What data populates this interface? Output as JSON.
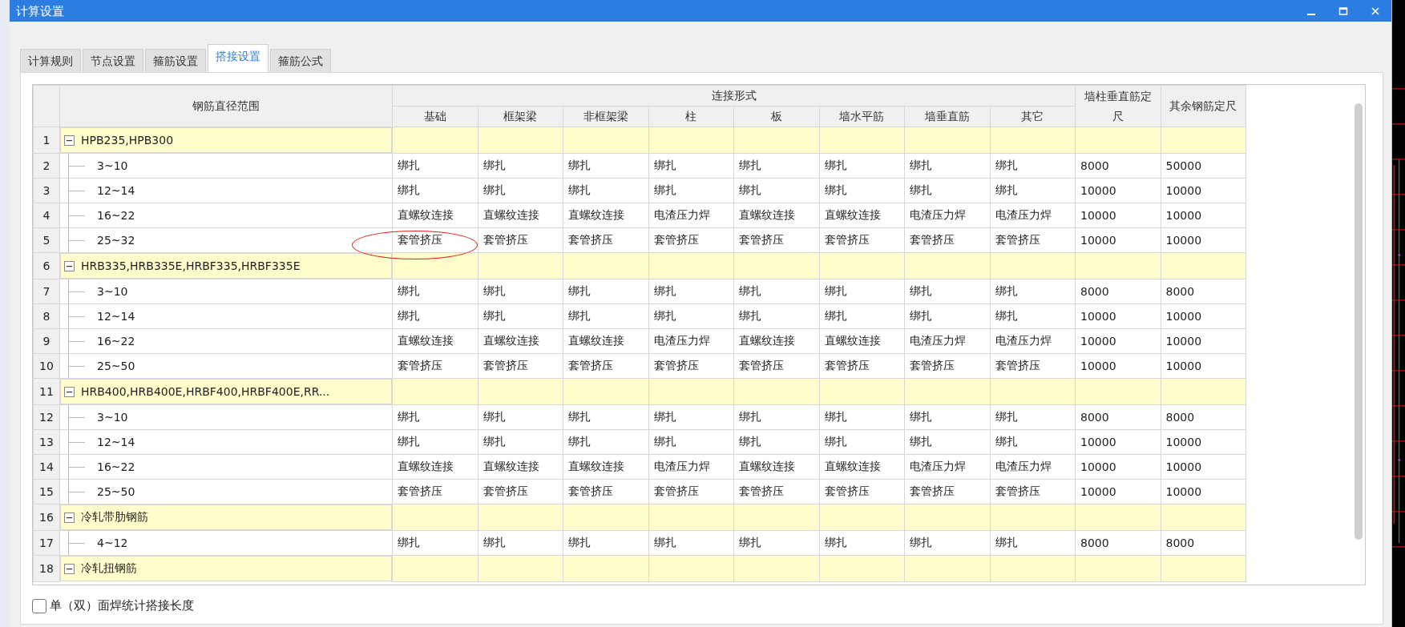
{
  "window": {
    "title": "计算设置"
  },
  "tabs": [
    {
      "label": "计算规则",
      "selected": false
    },
    {
      "label": "节点设置",
      "selected": false
    },
    {
      "label": "箍筋设置",
      "selected": false
    },
    {
      "label": "搭接设置",
      "selected": true
    },
    {
      "label": "箍筋公式",
      "selected": false
    }
  ],
  "table": {
    "range_header": "钢筋直径范围",
    "group_header": "连接形式",
    "group_columns": [
      "基础",
      "框架梁",
      "非框架梁",
      "柱",
      "板",
      "墙水平筋",
      "墙垂直筋",
      "其它"
    ],
    "extra_columns": [
      "墙柱垂直筋定尺",
      "其余钢筋定尺"
    ],
    "rows": [
      {
        "number": "1",
        "label": "HPB235,HPB300",
        "expanded": true,
        "children": [
          {
            "number": "2",
            "label": "3~10",
            "cells": [
              "绑扎",
              "绑扎",
              "绑扎",
              "绑扎",
              "绑扎",
              "绑扎",
              "绑扎",
              "绑扎",
              "8000",
              "50000"
            ]
          },
          {
            "number": "3",
            "label": "12~14",
            "cells": [
              "绑扎",
              "绑扎",
              "绑扎",
              "绑扎",
              "绑扎",
              "绑扎",
              "绑扎",
              "绑扎",
              "10000",
              "10000"
            ]
          },
          {
            "number": "4",
            "label": "16~22",
            "cells": [
              "直螺纹连接",
              "直螺纹连接",
              "直螺纹连接",
              "电渣压力焊",
              "直螺纹连接",
              "直螺纹连接",
              "电渣压力焊",
              "电渣压力焊",
              "10000",
              "10000"
            ]
          },
          {
            "number": "5",
            "label": "25~32",
            "circled": true,
            "cells": [
              "套管挤压",
              "套管挤压",
              "套管挤压",
              "套管挤压",
              "套管挤压",
              "套管挤压",
              "套管挤压",
              "套管挤压",
              "10000",
              "10000"
            ]
          }
        ]
      },
      {
        "number": "6",
        "label": "HRB335,HRB335E,HRBF335,HRBF335E",
        "expanded": true,
        "children": [
          {
            "number": "7",
            "label": "3~10",
            "cells": [
              "绑扎",
              "绑扎",
              "绑扎",
              "绑扎",
              "绑扎",
              "绑扎",
              "绑扎",
              "绑扎",
              "8000",
              "8000"
            ]
          },
          {
            "number": "8",
            "label": "12~14",
            "cells": [
              "绑扎",
              "绑扎",
              "绑扎",
              "绑扎",
              "绑扎",
              "绑扎",
              "绑扎",
              "绑扎",
              "10000",
              "10000"
            ]
          },
          {
            "number": "9",
            "label": "16~22",
            "cells": [
              "直螺纹连接",
              "直螺纹连接",
              "直螺纹连接",
              "电渣压力焊",
              "直螺纹连接",
              "直螺纹连接",
              "电渣压力焊",
              "电渣压力焊",
              "10000",
              "10000"
            ]
          },
          {
            "number": "10",
            "label": "25~50",
            "cells": [
              "套管挤压",
              "套管挤压",
              "套管挤压",
              "套管挤压",
              "套管挤压",
              "套管挤压",
              "套管挤压",
              "套管挤压",
              "10000",
              "10000"
            ]
          }
        ]
      },
      {
        "number": "11",
        "label": "HRB400,HRB400E,HRBF400,HRBF400E,RR...",
        "expanded": true,
        "children": [
          {
            "number": "12",
            "label": "3~10",
            "cells": [
              "绑扎",
              "绑扎",
              "绑扎",
              "绑扎",
              "绑扎",
              "绑扎",
              "绑扎",
              "绑扎",
              "8000",
              "8000"
            ]
          },
          {
            "number": "13",
            "label": "12~14",
            "cells": [
              "绑扎",
              "绑扎",
              "绑扎",
              "绑扎",
              "绑扎",
              "绑扎",
              "绑扎",
              "绑扎",
              "10000",
              "10000"
            ]
          },
          {
            "number": "14",
            "label": "16~22",
            "cells": [
              "直螺纹连接",
              "直螺纹连接",
              "直螺纹连接",
              "电渣压力焊",
              "直螺纹连接",
              "直螺纹连接",
              "电渣压力焊",
              "电渣压力焊",
              "10000",
              "10000"
            ]
          },
          {
            "number": "15",
            "label": "25~50",
            "cells": [
              "套管挤压",
              "套管挤压",
              "套管挤压",
              "套管挤压",
              "套管挤压",
              "套管挤压",
              "套管挤压",
              "套管挤压",
              "10000",
              "10000"
            ]
          }
        ]
      },
      {
        "number": "16",
        "label": "冷轧带肋钢筋",
        "expanded": true,
        "children": [
          {
            "number": "17",
            "label": "4~12",
            "cells": [
              "绑扎",
              "绑扎",
              "绑扎",
              "绑扎",
              "绑扎",
              "绑扎",
              "绑扎",
              "绑扎",
              "8000",
              "8000"
            ]
          }
        ]
      },
      {
        "number": "18",
        "label": "冷轧扭钢筋",
        "expanded": true,
        "children": []
      }
    ]
  },
  "option": {
    "label": "单（双）面焊统计搭接长度",
    "checked": false
  }
}
